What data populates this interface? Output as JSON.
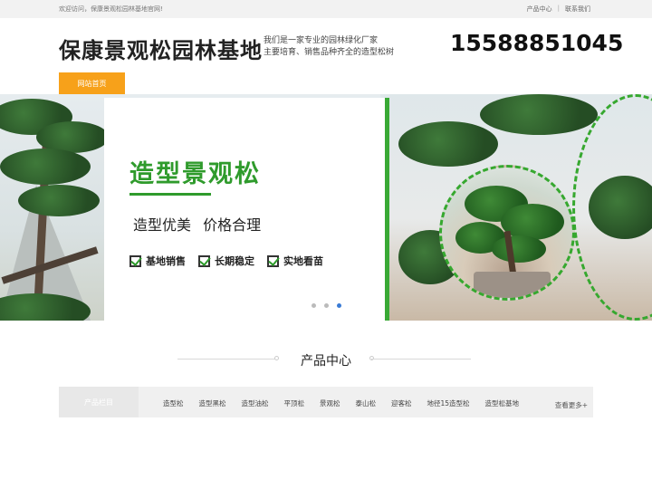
{
  "topbar": {
    "welcome": "欢迎访问，保康景观松园林基地官网!",
    "links": [
      "产品中心",
      "联系我们"
    ],
    "separator": "|"
  },
  "header": {
    "site_title": "保康景观松园林基地",
    "slogan_line1": "我们是一家专业的园林绿化厂家",
    "slogan_line2": "主要培育、销售品种齐全的造型松树",
    "phone": "15588851045"
  },
  "nav": {
    "home_label": "网站首页"
  },
  "banner": {
    "headline": "造型景观松",
    "subline": "造型优美 价格合理",
    "features": [
      "基地销售",
      "长期稳定",
      "实地看苗"
    ],
    "active_slide": 3,
    "slide_count": 3,
    "accent_color": "#2f9b2c"
  },
  "products": {
    "section_title": "产品中心",
    "category_title": "产品栏目",
    "items": [
      "造型松",
      "造型黑松",
      "造型油松",
      "平顶松",
      "景观松",
      "泰山松",
      "迎客松",
      "地径15造型松",
      "造型松基地"
    ],
    "more_label": "查看更多+"
  },
  "colors": {
    "nav_orange": "#f7a11a",
    "slider_active": "#3a7bd5"
  }
}
